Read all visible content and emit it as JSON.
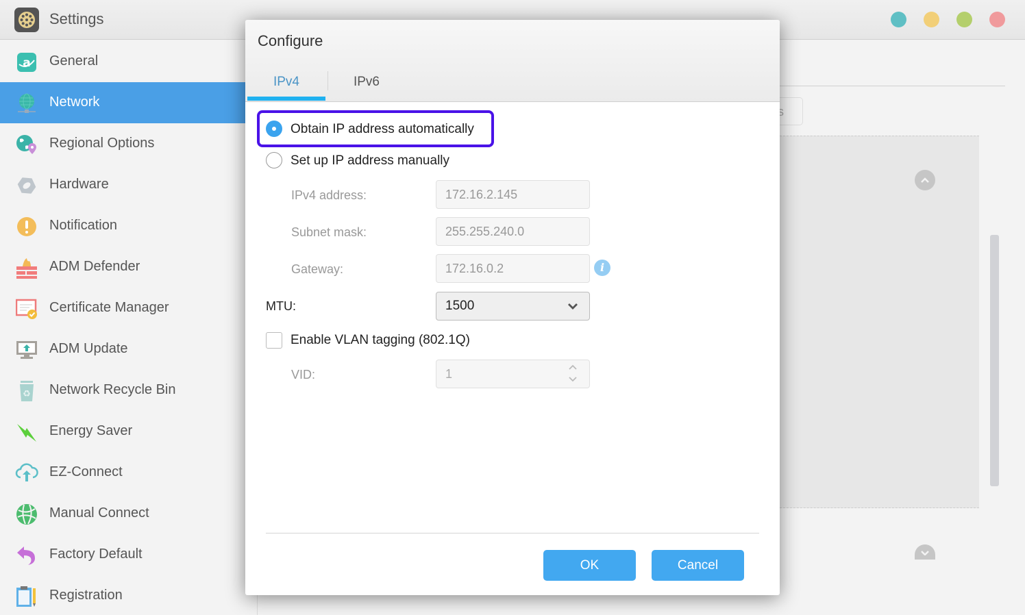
{
  "window": {
    "title": "Settings",
    "controls": [
      {
        "name": "help",
        "color": "#5fbfc4"
      },
      {
        "name": "minimize",
        "color": "#f2cf78"
      },
      {
        "name": "maximize",
        "color": "#b4cf6c"
      },
      {
        "name": "close",
        "color": "#f09a9c"
      }
    ]
  },
  "sidebar": {
    "items": [
      {
        "label": "General",
        "icon": "general-icon",
        "active": false
      },
      {
        "label": "Network",
        "icon": "network-globe-icon",
        "active": true
      },
      {
        "label": "Regional Options",
        "icon": "regional-globe-pin-icon",
        "active": false
      },
      {
        "label": "Hardware",
        "icon": "hardware-nut-icon",
        "active": false
      },
      {
        "label": "Notification",
        "icon": "exclamation-icon",
        "active": false
      },
      {
        "label": "ADM Defender",
        "icon": "firewall-icon",
        "active": false
      },
      {
        "label": "Certificate Manager",
        "icon": "certificate-icon",
        "active": false
      },
      {
        "label": "ADM Update",
        "icon": "monitor-upload-icon",
        "active": false
      },
      {
        "label": "Network Recycle Bin",
        "icon": "recycle-bin-icon",
        "active": false
      },
      {
        "label": "Energy Saver",
        "icon": "lightning-icon",
        "active": false
      },
      {
        "label": "EZ-Connect",
        "icon": "cloud-upload-icon",
        "active": false
      },
      {
        "label": "Manual Connect",
        "icon": "green-globe-icon",
        "active": false
      },
      {
        "label": "Factory Default",
        "icon": "undo-arrow-icon",
        "active": false
      },
      {
        "label": "Registration",
        "icon": "clipboard-pencil-icon",
        "active": false
      }
    ]
  },
  "background": {
    "button_partial_text": "s"
  },
  "dialog": {
    "title": "Configure",
    "tabs": [
      {
        "label": "IPv4",
        "active": true
      },
      {
        "label": "IPv6",
        "active": false
      }
    ],
    "ip_mode": {
      "options": [
        {
          "label": "Obtain IP address automatically",
          "selected": true
        },
        {
          "label": "Set up IP address manually",
          "selected": false
        }
      ]
    },
    "fields": {
      "ipv4_address": {
        "label": "IPv4 address:",
        "value": "172.16.2.145"
      },
      "subnet_mask": {
        "label": "Subnet mask:",
        "value": "255.255.240.0"
      },
      "gateway": {
        "label": "Gateway:",
        "value": "172.16.0.2"
      },
      "mtu": {
        "label": "MTU:",
        "value": "1500"
      },
      "vlan": {
        "label": "Enable VLAN tagging (802.1Q)",
        "checked": false
      },
      "vid": {
        "label": "VID:",
        "value": "1"
      }
    },
    "buttons": {
      "ok": "OK",
      "cancel": "Cancel"
    },
    "accent_color": "#42a8f0",
    "highlight_color": "#4a12e8"
  }
}
